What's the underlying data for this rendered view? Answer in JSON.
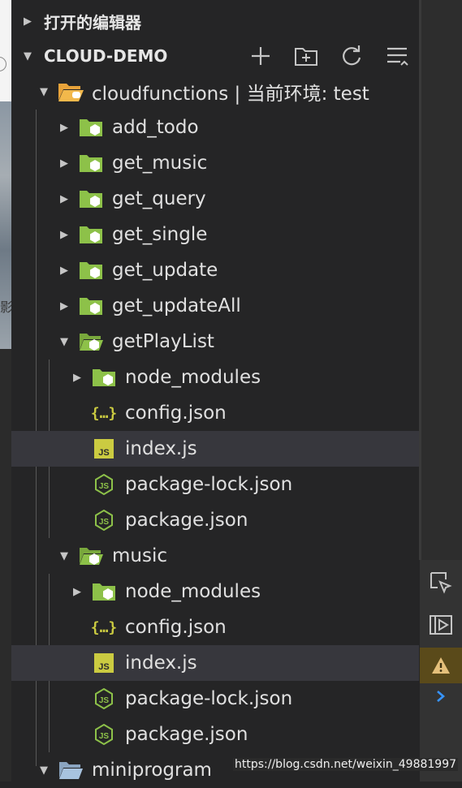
{
  "open_editors": {
    "title": "打开的编辑器"
  },
  "workspace": {
    "title": "CLOUD-DEMO"
  },
  "tree": {
    "cloudfunctions": "cloudfunctions | 当前环境: test",
    "add_todo": "add_todo",
    "get_music": "get_music",
    "get_query": "get_query",
    "get_single": "get_single",
    "get_update": "get_update",
    "get_updateAll": "get_updateAll",
    "getPlayList": "getPlayList",
    "gpl_node_modules": "node_modules",
    "gpl_config": "config.json",
    "gpl_index": "index.js",
    "gpl_lock": "package-lock.json",
    "gpl_package": "package.json",
    "music": "music",
    "mu_node_modules": "node_modules",
    "mu_config": "config.json",
    "mu_index": "index.js",
    "mu_lock": "package-lock.json",
    "mu_package": "package.json",
    "miniprogram": "miniprogram"
  },
  "left_clip": {
    "glyph": "影"
  },
  "watermark": "https://blog.csdn.net/weixin_49881997",
  "colors": {
    "folder_green": "#8dc149",
    "js_yellow": "#cbcb41",
    "json_yellow": "#cbcb41",
    "warn": "#e5c07b"
  }
}
